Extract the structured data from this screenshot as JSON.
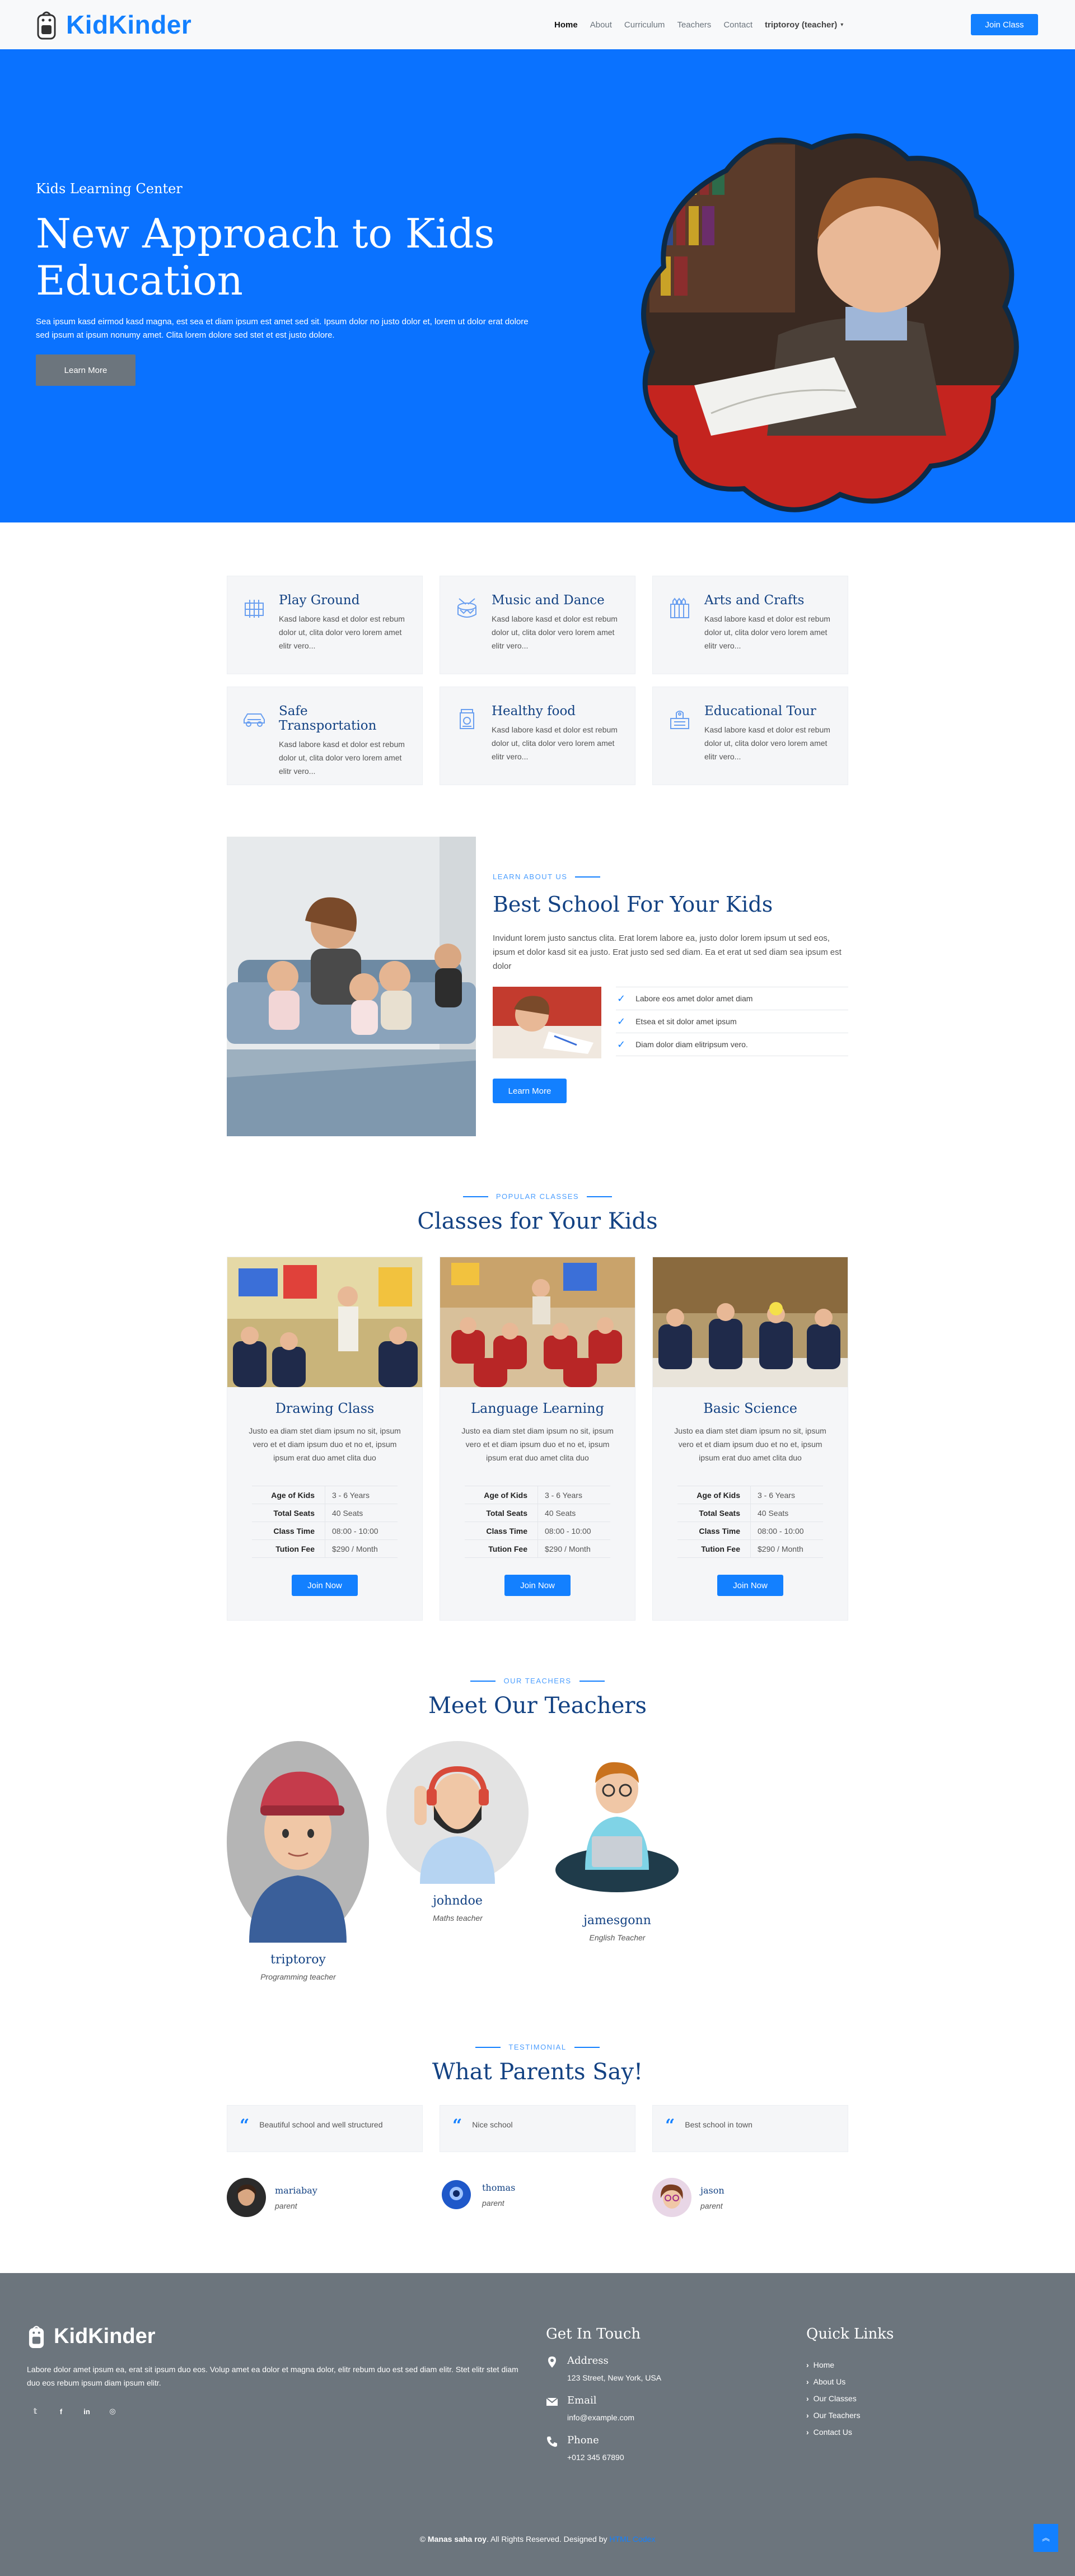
{
  "nav": {
    "brand": "KidKinder",
    "links": [
      "Home",
      "About",
      "Curriculum",
      "Teachers",
      "Contact"
    ],
    "user": "triptoroy (teacher)",
    "cta": "Join Class"
  },
  "hero": {
    "subtitle": "Kids Learning Center",
    "title": "New Approach to Kids Education",
    "description": "Sea ipsum kasd eirmod kasd magna, est sea et diam ipsum est amet sed sit. Ipsum dolor no justo dolor et, lorem ut dolor erat dolore sed ipsum at ipsum nonumy amet. Clita lorem dolore sed stet et est justo dolore.",
    "button": "Learn More"
  },
  "facilities": [
    {
      "title": "Play Ground",
      "text": "Kasd labore kasd et dolor est rebum dolor ut, clita dolor vero lorem amet elitr vero...",
      "icon": "playground-icon"
    },
    {
      "title": "Music and Dance",
      "text": "Kasd labore kasd et dolor est rebum dolor ut, clita dolor vero lorem amet elitr vero...",
      "icon": "drum-icon"
    },
    {
      "title": "Arts and Crafts",
      "text": "Kasd labore kasd et dolor est rebum dolor ut, clita dolor vero lorem amet elitr vero...",
      "icon": "crayons-icon"
    },
    {
      "title": "Safe Transportation",
      "text": "Kasd labore kasd et dolor est rebum dolor ut, clita dolor vero lorem amet elitr vero...",
      "icon": "car-icon"
    },
    {
      "title": "Healthy food",
      "text": "Kasd labore kasd et dolor est rebum dolor ut, clita dolor vero lorem amet elitr vero...",
      "icon": "food-jar-icon"
    },
    {
      "title": "Educational Tour",
      "text": "Kasd labore kasd et dolor est rebum dolor ut, clita dolor vero lorem amet elitr vero...",
      "icon": "tour-icon"
    }
  ],
  "about": {
    "label": "LEARN ABOUT US",
    "title": "Best School For Your Kids",
    "text": "Invidunt lorem justo sanctus clita. Erat lorem labore ea, justo dolor lorem ipsum ut sed eos, ipsum et dolor kasd sit ea justo. Erat justo sed sed diam. Ea et erat ut sed diam sea ipsum est dolor",
    "checks": [
      "Labore eos amet dolor amet diam",
      "Etsea et sit dolor amet ipsum",
      "Diam dolor diam elitripsum vero."
    ],
    "button": "Learn More"
  },
  "classes": {
    "label": "POPULAR CLASSES",
    "title": "Classes for Your Kids",
    "items": [
      {
        "name": "Drawing Class",
        "desc": "Justo ea diam stet diam ipsum no sit, ipsum vero et et diam ipsum duo et no et, ipsum ipsum erat duo amet clita duo",
        "age": "3 - 6 Years",
        "seats": "40 Seats",
        "time": "08:00 - 10:00",
        "fee": "$290 / Month",
        "button": "Join Now"
      },
      {
        "name": "Language Learning",
        "desc": "Justo ea diam stet diam ipsum no sit, ipsum vero et et diam ipsum duo et no et, ipsum ipsum erat duo amet clita duo",
        "age": "3 - 6 Years",
        "seats": "40 Seats",
        "time": "08:00 - 10:00",
        "fee": "$290 / Month",
        "button": "Join Now"
      },
      {
        "name": "Basic Science",
        "desc": "Justo ea diam stet diam ipsum no sit, ipsum vero et et diam ipsum duo et no et, ipsum ipsum erat duo amet clita duo",
        "age": "3 - 6 Years",
        "seats": "40 Seats",
        "time": "08:00 - 10:00",
        "fee": "$290 / Month",
        "button": "Join Now"
      }
    ],
    "keys": {
      "age": "Age of Kids",
      "seats": "Total Seats",
      "time": "Class Time",
      "fee": "Tution Fee"
    }
  },
  "teachers": {
    "label": "OUR TEACHERS",
    "title": "Meet Our Teachers",
    "items": [
      {
        "name": "triptoroy",
        "role": "Programming teacher"
      },
      {
        "name": "johndoe",
        "role": "Maths teacher"
      },
      {
        "name": "jamesgonn",
        "role": "English Teacher"
      }
    ]
  },
  "testimonials": {
    "label": "TESTIMONIAL",
    "title": "What Parents Say!",
    "items": [
      {
        "quote": "Beautiful school and well structured",
        "name": "mariabay",
        "role": "parent"
      },
      {
        "quote": "Nice school",
        "name": "thomas",
        "role": "parent"
      },
      {
        "quote": "Best school in town",
        "name": "jason",
        "role": "parent"
      }
    ]
  },
  "footer": {
    "brand": "KidKinder",
    "desc": "Labore dolor amet ipsum ea, erat sit ipsum duo eos. Volup amet ea dolor et magna dolor, elitr rebum duo est sed diam elitr. Stet elitr stet diam duo eos rebum ipsum diam ipsum elitr.",
    "socials": [
      "twitter-icon",
      "facebook-icon",
      "linkedin-icon",
      "instagram-icon"
    ],
    "contact_title": "Get In Touch",
    "address_label": "Address",
    "address": "123 Street, New York, USA",
    "email_label": "Email",
    "email": "info@example.com",
    "phone_label": "Phone",
    "phone": "+012 345 67890",
    "links_title": "Quick Links",
    "links": [
      "Home",
      "About Us",
      "Our Classes",
      "Our Teachers",
      "Contact Us"
    ],
    "copyright_prefix": "©",
    "copyright_owner": "Manas saha roy",
    "copyright_mid": ". All Rights Reserved. Designed by",
    "designer": "HTML Codex"
  },
  "colors": {
    "primary": "#1380ff",
    "heading": "#134283",
    "footer": "#6c757d",
    "hero": "#0a72ff"
  }
}
